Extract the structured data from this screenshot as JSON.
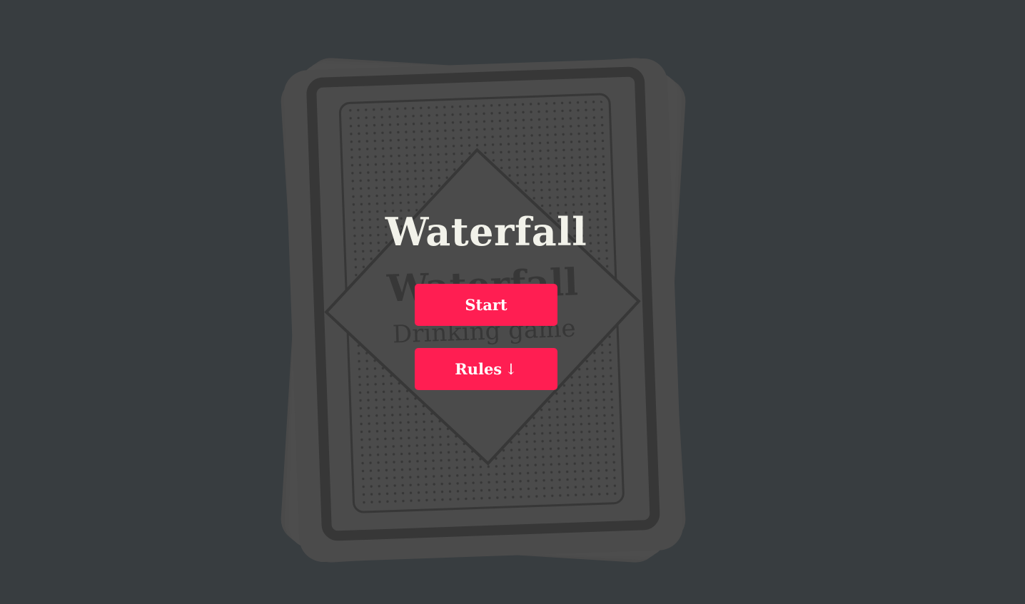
{
  "app": {
    "title": "Waterfall"
  },
  "card_back": {
    "title": "Waterfall",
    "subtitle": "Drinking game"
  },
  "buttons": {
    "start_label": "Start",
    "rules_label": "Rules",
    "rules_arrow": "↓"
  },
  "colors": {
    "background": "#383d40",
    "card": "#4b4b4b",
    "card_line": "#373737",
    "button": "#ff1e52",
    "title_text": "#f2f2ea"
  },
  "icons": {
    "rules_arrow": "down-arrow-icon"
  }
}
